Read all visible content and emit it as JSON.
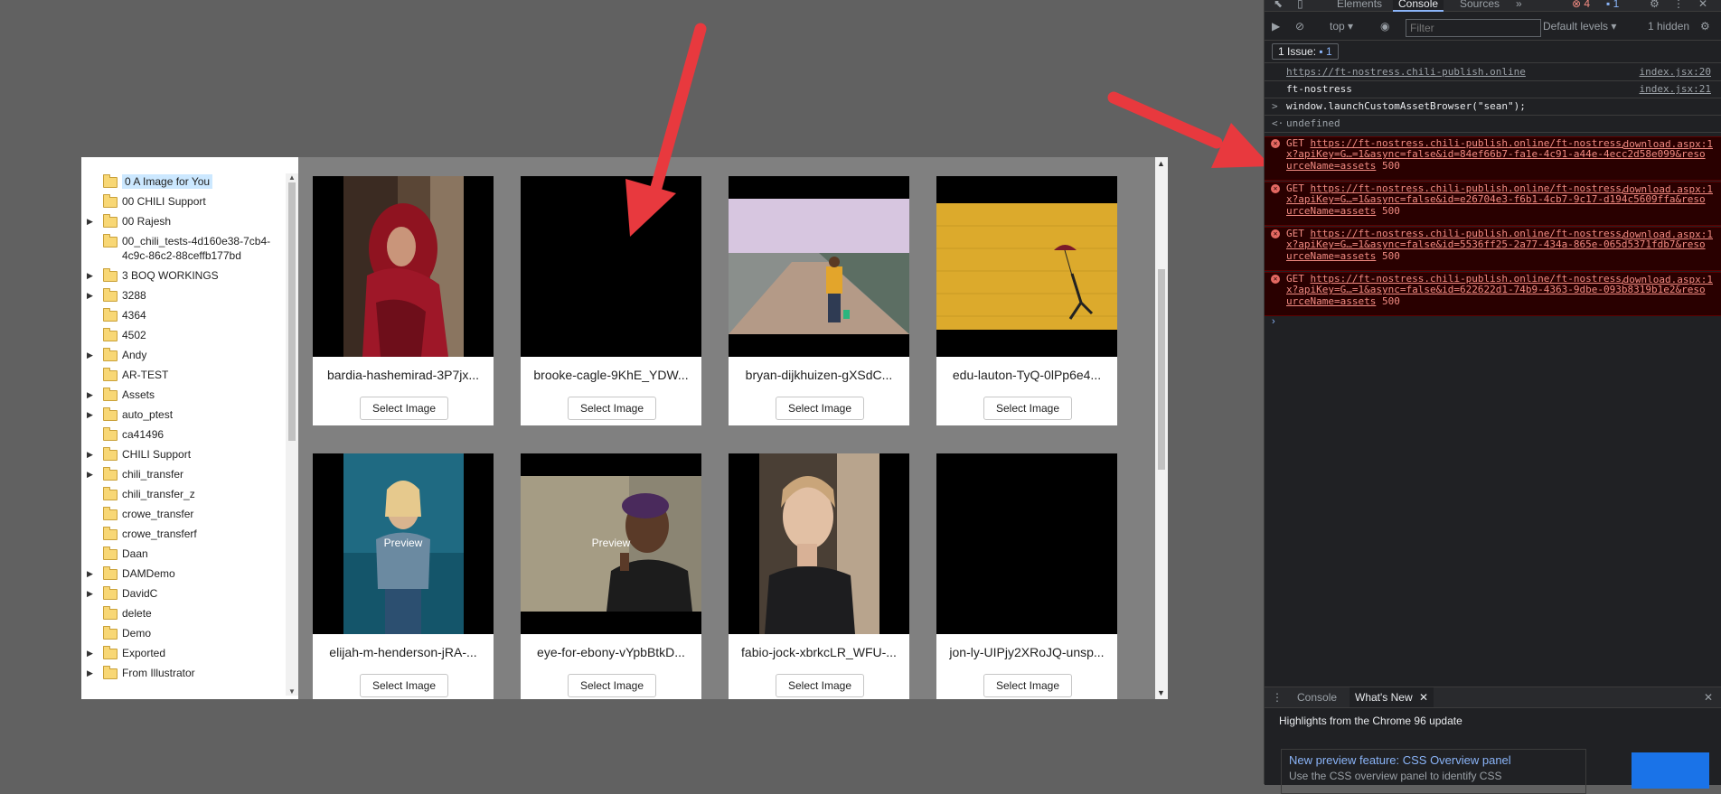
{
  "folders": [
    {
      "label": "0 A Image for You",
      "expandable": false,
      "selected": true
    },
    {
      "label": "00 CHILI Support",
      "expandable": false
    },
    {
      "label": "00 Rajesh",
      "expandable": true
    },
    {
      "label": "00_chili_tests-4d160e38-7cb4-4c9c-86c2-88ceffb177bd",
      "expandable": false
    },
    {
      "label": "3 BOQ WORKINGS",
      "expandable": true
    },
    {
      "label": "3288",
      "expandable": true
    },
    {
      "label": "4364",
      "expandable": false
    },
    {
      "label": "4502",
      "expandable": false
    },
    {
      "label": "Andy",
      "expandable": true
    },
    {
      "label": "AR-TEST",
      "expandable": false
    },
    {
      "label": "Assets",
      "expandable": true
    },
    {
      "label": "auto_ptest",
      "expandable": true
    },
    {
      "label": "ca41496",
      "expandable": false
    },
    {
      "label": "CHILI Support",
      "expandable": true
    },
    {
      "label": "chili_transfer",
      "expandable": true
    },
    {
      "label": "chili_transfer_z",
      "expandable": false
    },
    {
      "label": "crowe_transfer",
      "expandable": false
    },
    {
      "label": "crowe_transferf",
      "expandable": false
    },
    {
      "label": "Daan",
      "expandable": false
    },
    {
      "label": "DAMDemo",
      "expandable": true
    },
    {
      "label": "DavidC",
      "expandable": true
    },
    {
      "label": "delete",
      "expandable": false
    },
    {
      "label": "Demo",
      "expandable": false
    },
    {
      "label": "Exported",
      "expandable": true
    },
    {
      "label": "From Illustrator",
      "expandable": true
    }
  ],
  "images": [
    {
      "name": "bardia-hashemirad-3P7jx...",
      "button": "Select Image",
      "preview": ""
    },
    {
      "name": "brooke-cagle-9KhE_YDW...",
      "button": "Select Image",
      "preview": ""
    },
    {
      "name": "bryan-dijkhuizen-gXSdC...",
      "button": "Select Image",
      "preview": ""
    },
    {
      "name": "edu-lauton-TyQ-0lPp6e4...",
      "button": "Select Image",
      "preview": ""
    },
    {
      "name": "elijah-m-henderson-jRA-...",
      "button": "Select Image",
      "preview": "Preview"
    },
    {
      "name": "eye-for-ebony-vYpbBtkD...",
      "button": "Select Image",
      "preview": "Preview"
    },
    {
      "name": "fabio-jock-xbrkcLR_WFU-...",
      "button": "Select Image",
      "preview": ""
    },
    {
      "name": "jon-ly-UIPjy2XRoJQ-unsp...",
      "button": "Select Image",
      "preview": ""
    }
  ],
  "devtools": {
    "tabs": [
      "Elements",
      "Console",
      "Sources",
      "»"
    ],
    "active_tab": "Console",
    "error_count": "4",
    "info_count": "1",
    "context": "top ▾",
    "filter_placeholder": "Filter",
    "levels": "Default levels ▾",
    "hidden": "1 hidden",
    "issues_label": "1 Issue:",
    "issues_count": "1",
    "logs": [
      {
        "text": "https://ft-nostress.chili-publish.online",
        "source": "index.jsx:20",
        "link": true
      },
      {
        "text": "ft-nostress",
        "source": "index.jsx:21",
        "link": false
      },
      {
        "text": "window.launchCustomAssetBrowser(\"sean\");",
        "prefix": ">",
        "source": ""
      },
      {
        "text": "undefined",
        "prefix": "<·",
        "source": ""
      }
    ],
    "errors": [
      {
        "method": "GET",
        "url": "https://ft-nostress.chili-publish.online/ft-nostress/download.aspx?apiKey=G…=1&async=false&id=84ef66b7-fa1e-4c91-a44e-4ecc2d58e099&resourceName=assets",
        "status": "500",
        "source": "download.aspx:1"
      },
      {
        "method": "GET",
        "url": "https://ft-nostress.chili-publish.online/ft-nostress/download.aspx?apiKey=G…=1&async=false&id=e26704e3-f6b1-4cb7-9c17-d194c5609ffa&resourceName=assets",
        "status": "500",
        "source": "download.aspx:1"
      },
      {
        "method": "GET",
        "url": "https://ft-nostress.chili-publish.online/ft-nostress/download.aspx?apiKey=G…=1&async=false&id=5536ff25-2a77-434a-865e-065d5371fdb7&resourceName=assets",
        "status": "500",
        "source": "download.aspx:1"
      },
      {
        "method": "GET",
        "url": "https://ft-nostress.chili-publish.online/ft-nostress/download.aspx?apiKey=G…=1&async=false&id=622622d1-74b9-4363-9dbe-093b8319b1e2&resourceName=assets",
        "status": "500",
        "source": "download.aspx:1"
      }
    ],
    "drawer": {
      "tabs": [
        "Console",
        "What's New"
      ],
      "active": "What's New",
      "highlights": "Highlights from the Chrome 96 update",
      "feature_title": "New preview feature: CSS Overview panel",
      "feature_desc": "Use the CSS overview panel to identify CSS"
    }
  },
  "colors": {
    "background": "#616161",
    "error_bg": "#290000",
    "error_text": "#f28b82",
    "arrow": "#e8393e"
  }
}
